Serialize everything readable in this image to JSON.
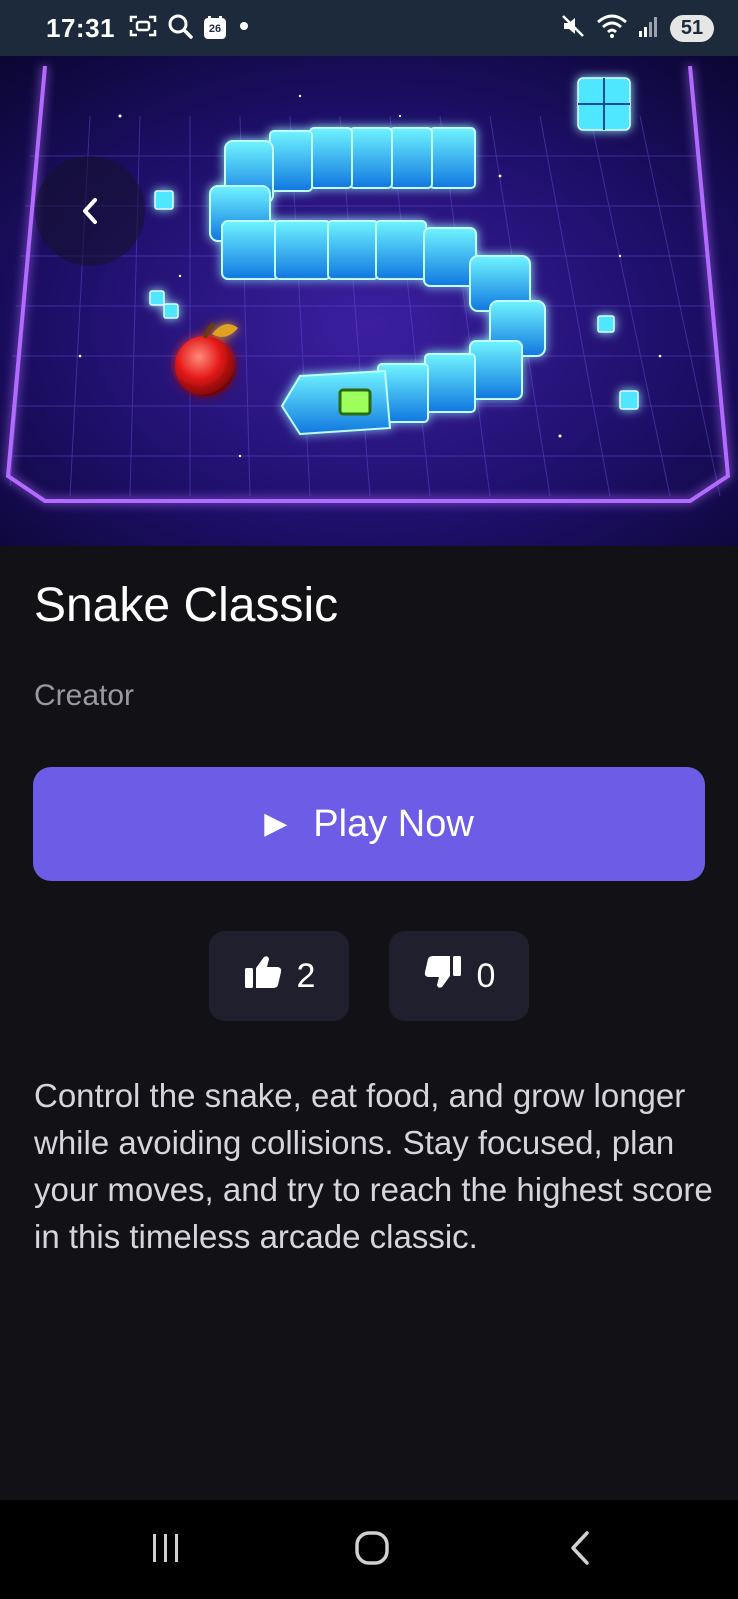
{
  "status_bar": {
    "time": "17:31",
    "calendar_day": "26",
    "battery": "51",
    "left_icons": [
      "screenshot-icon",
      "search-icon",
      "calendar-icon",
      "dot-icon"
    ],
    "right_icons": [
      "mute-icon",
      "wifi-icon",
      "signal-icon"
    ]
  },
  "hero": {
    "image": "neon snake game artwork",
    "back_icon": "chevron-left-icon"
  },
  "game": {
    "title": "Snake Classic",
    "creator": "Creator",
    "play_label": "Play Now",
    "play_icon": "▶",
    "likes": "2",
    "dislikes": "0",
    "description": "Control the snake, eat food, and grow longer while avoiding collisions. Stay focused, plan your moves, and try to reach the highest score in this timeless arcade classic."
  },
  "colors": {
    "accent": "#6c5ce6",
    "background": "#121116",
    "card": "#201f2e",
    "status_bar": "#1c2a3c"
  },
  "nav_bar": {
    "buttons": [
      "recents-icon",
      "home-icon",
      "back-icon"
    ]
  }
}
